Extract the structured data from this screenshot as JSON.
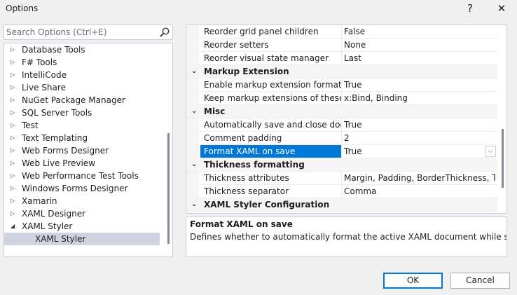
{
  "window": {
    "title": "Options",
    "help_glyph": "?",
    "close_glyph": "✕"
  },
  "search": {
    "placeholder": "Search Options (Ctrl+E)"
  },
  "tree": {
    "items": [
      {
        "label": "Database Tools",
        "state": "collapsed"
      },
      {
        "label": "F# Tools",
        "state": "collapsed"
      },
      {
        "label": "IntelliCode",
        "state": "collapsed"
      },
      {
        "label": "Live Share",
        "state": "collapsed"
      },
      {
        "label": "NuGet Package Manager",
        "state": "collapsed"
      },
      {
        "label": "SQL Server Tools",
        "state": "collapsed"
      },
      {
        "label": "Test",
        "state": "collapsed"
      },
      {
        "label": "Text Templating",
        "state": "collapsed"
      },
      {
        "label": "Web Forms Designer",
        "state": "collapsed"
      },
      {
        "label": "Web Live Preview",
        "state": "collapsed"
      },
      {
        "label": "Web Performance Test Tools",
        "state": "collapsed"
      },
      {
        "label": "Windows Forms Designer",
        "state": "collapsed"
      },
      {
        "label": "Xamarin",
        "state": "collapsed"
      },
      {
        "label": "XAML Designer",
        "state": "collapsed"
      },
      {
        "label": "XAML Styler",
        "state": "expanded"
      },
      {
        "label": "XAML Styler",
        "state": "child-selected"
      }
    ]
  },
  "properties": {
    "rows": [
      {
        "type": "prop",
        "name": "Reorder grid panel children",
        "value": "False"
      },
      {
        "type": "prop",
        "name": "Reorder setters",
        "value": "None"
      },
      {
        "type": "prop",
        "name": "Reorder visual state manager",
        "value": "Last"
      },
      {
        "type": "cat",
        "name": "Markup Extension"
      },
      {
        "type": "prop",
        "name": "Enable markup extension formatting",
        "value": "True"
      },
      {
        "type": "prop",
        "name": "Keep markup extensions of these typ",
        "value": "x:Bind, Binding"
      },
      {
        "type": "cat",
        "name": "Misc"
      },
      {
        "type": "prop",
        "name": "Automatically save and close docum",
        "value": "True"
      },
      {
        "type": "prop",
        "name": "Comment padding",
        "value": "2"
      },
      {
        "type": "prop",
        "name": "Format XAML on save",
        "value": "True",
        "selected": true
      },
      {
        "type": "cat",
        "name": "Thickness formatting"
      },
      {
        "type": "prop",
        "name": "Thickness attributes",
        "value": "Margin, Padding, BorderThickness, Thum"
      },
      {
        "type": "prop",
        "name": "Thickness separator",
        "value": "Comma"
      },
      {
        "type": "cat",
        "name": "XAML Styler Configuration"
      }
    ]
  },
  "description": {
    "title": "Format XAML on save",
    "text": "Defines whether to automatically format the active XAML document while saving."
  },
  "buttons": {
    "ok": "OK",
    "cancel": "Cancel"
  },
  "colors": {
    "selection": "#0078d7",
    "tree_selection": "#cfd3df",
    "border": "#cccedb"
  }
}
